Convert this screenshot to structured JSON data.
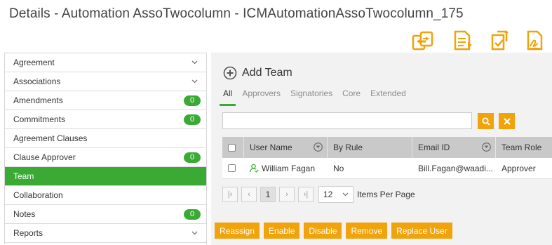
{
  "page": {
    "title": "Details - Automation AssoTwocolumn - ICMAutomationAssoTwocolumn_175"
  },
  "toolbar": {
    "icons": [
      "transfer-icon",
      "document-add-icon",
      "document-share-icon",
      "document-signature-icon"
    ],
    "color": "#f0a30a"
  },
  "sidebar": {
    "items": [
      {
        "label": "Agreement",
        "chevron": true
      },
      {
        "label": "Associations",
        "chevron": true
      },
      {
        "label": "Amendments",
        "badge": "0"
      },
      {
        "label": "Commitments",
        "badge": "0"
      },
      {
        "label": "Agreement Clauses"
      },
      {
        "label": "Clause Approver",
        "badge": "0"
      },
      {
        "label": "Team",
        "active": true
      },
      {
        "label": "Collaboration"
      },
      {
        "label": "Notes",
        "badge": "0"
      },
      {
        "label": "Reports",
        "chevron": true
      }
    ]
  },
  "main": {
    "add_label": "Add Team",
    "tabs": [
      "All",
      "Approvers",
      "Signatories",
      "Core",
      "Extended"
    ],
    "active_tab": "All",
    "search": {
      "value": "",
      "placeholder": ""
    },
    "grid": {
      "columns": [
        "User Name",
        "By Rule",
        "Email ID",
        "Team Role"
      ],
      "rows": [
        {
          "user": "William Fagan",
          "by_rule": "No",
          "email": "Bill.Fagan@waadi...",
          "role": "Approver"
        }
      ]
    },
    "pager": {
      "current_page": "1",
      "per_page": "12",
      "per_page_label": "Items Per Page"
    },
    "actions": [
      "Reassign",
      "Enable",
      "Disable",
      "Remove",
      "Replace User"
    ]
  },
  "colors": {
    "accent_green": "#3aaa35",
    "accent_orange": "#f0a30a"
  }
}
